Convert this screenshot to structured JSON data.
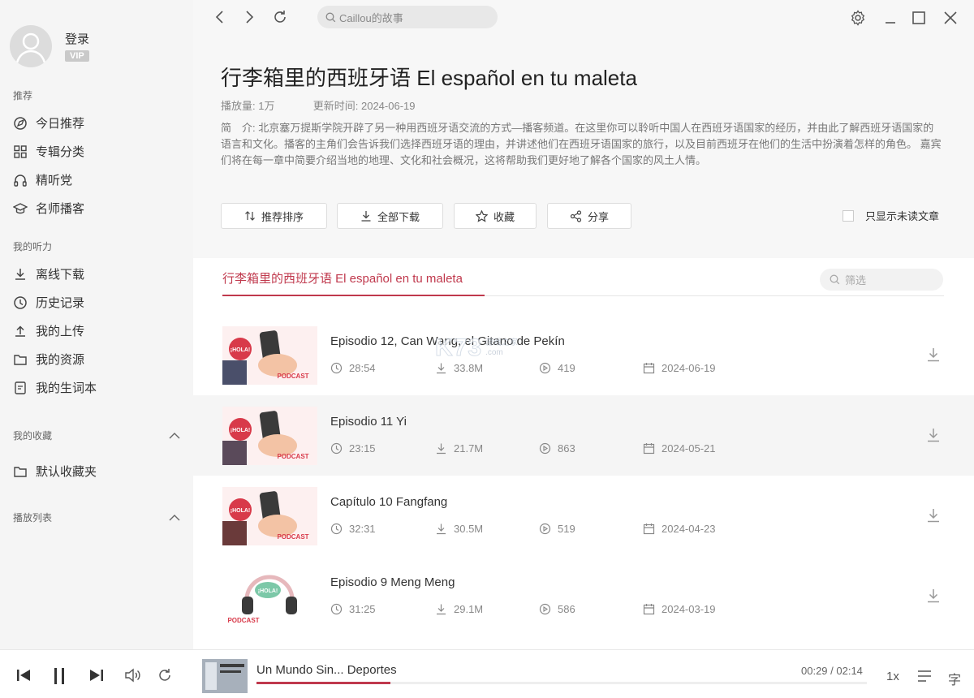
{
  "sidebar": {
    "login_label": "登录",
    "vip_label": "VIP",
    "section_recommend": "推荐",
    "recommend_items": [
      {
        "label": "今日推荐",
        "icon": "compass-icon"
      },
      {
        "label": "专辑分类",
        "icon": "grid-icon"
      },
      {
        "label": "精听党",
        "icon": "headphones-icon"
      },
      {
        "label": "名师播客",
        "icon": "graduation-cap-icon"
      }
    ],
    "section_listening": "我的听力",
    "listening_items": [
      {
        "label": "离线下载",
        "icon": "download-icon"
      },
      {
        "label": "历史记录",
        "icon": "clock-icon"
      },
      {
        "label": "我的上传",
        "icon": "upload-icon"
      },
      {
        "label": "我的资源",
        "icon": "folder-icon"
      },
      {
        "label": "我的生词本",
        "icon": "notebook-icon"
      }
    ],
    "section_favorites": "我的收藏",
    "favorite_items": [
      {
        "label": "默认收藏夹",
        "icon": "folder-icon"
      }
    ],
    "section_playlist": "播放列表"
  },
  "topbar": {
    "search_placeholder": "Caillou的故事"
  },
  "album": {
    "title": "行李箱里的西班牙语 El español en tu maleta",
    "plays_label": "播放量:",
    "plays_value": "1万",
    "updated_label": "更新时间:",
    "updated_value": "2024-06-19",
    "description": "简　介: 北京塞万提斯学院开辟了另一种用西班牙语交流的方式—播客频道。在这里你可以聆听中国人在西班牙语国家的经历，并由此了解西班牙语国家的语言和文化。播客的主角们会告诉我们选择西班牙语的理由，并讲述他们在西班牙语国家的旅行，以及目前西班牙在他们的生活中扮演着怎样的角色。 嘉宾们将在每一章中简要介绍当地的地理、文化和社会概况，这将帮助我们更好地了解各个国家的风土人情。"
  },
  "actions": {
    "sort_label": "推荐排序",
    "download_all_label": "全部下载",
    "favorite_label": "收藏",
    "share_label": "分享",
    "unread_only_label": "只显示未读文章"
  },
  "tab": {
    "label": "行李箱里的西班牙语 El español en tu maleta",
    "filter_placeholder": "筛选"
  },
  "episodes": [
    {
      "title": "Episodio 12, Can Wang, el Gitano de Pekín",
      "duration": "28:54",
      "size": "33.8M",
      "plays": "419",
      "date": "2024-06-19"
    },
    {
      "title": "Episodio 11 Yi",
      "duration": "23:15",
      "size": "21.7M",
      "plays": "863",
      "date": "2024-05-21"
    },
    {
      "title": "Capítulo 10 Fangfang",
      "duration": "32:31",
      "size": "30.5M",
      "plays": "519",
      "date": "2024-04-23"
    },
    {
      "title": "Episodio 9 Meng Meng",
      "duration": "31:25",
      "size": "29.1M",
      "plays": "586",
      "date": "2024-03-19"
    }
  ],
  "thumb_text": {
    "hola": "¡HOLA!",
    "podcast": "PODCAST"
  },
  "watermark": {
    "brand": "K73",
    "sub1": "游戏之家",
    "sub2": ".com"
  },
  "player": {
    "track": "Un Mundo Sin... Deportes",
    "time": "00:29 / 02:14",
    "progress_fraction": 0.22,
    "speed": "1x",
    "lyrics_label": "字"
  },
  "colors": {
    "accent": "#c0394d",
    "sidebar_bg": "#f5f5f5",
    "header_bg": "#f7f7f7"
  }
}
